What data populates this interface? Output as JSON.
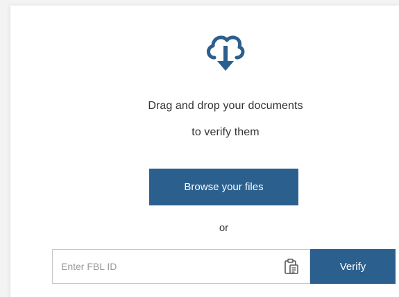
{
  "upload": {
    "icon": "cloud-download-icon",
    "prompt_line1": "Drag and drop your documents",
    "prompt_line2": "to verify them",
    "browse_label": "Browse your files",
    "or_label": "or"
  },
  "verify": {
    "input_placeholder": "Enter FBL ID",
    "input_value": "",
    "paste_icon": "clipboard-paste-icon",
    "verify_label": "Verify"
  },
  "colors": {
    "accent": "#2b5f8e",
    "text": "#333333",
    "background": "#f3f3f3",
    "card": "#ffffff"
  }
}
